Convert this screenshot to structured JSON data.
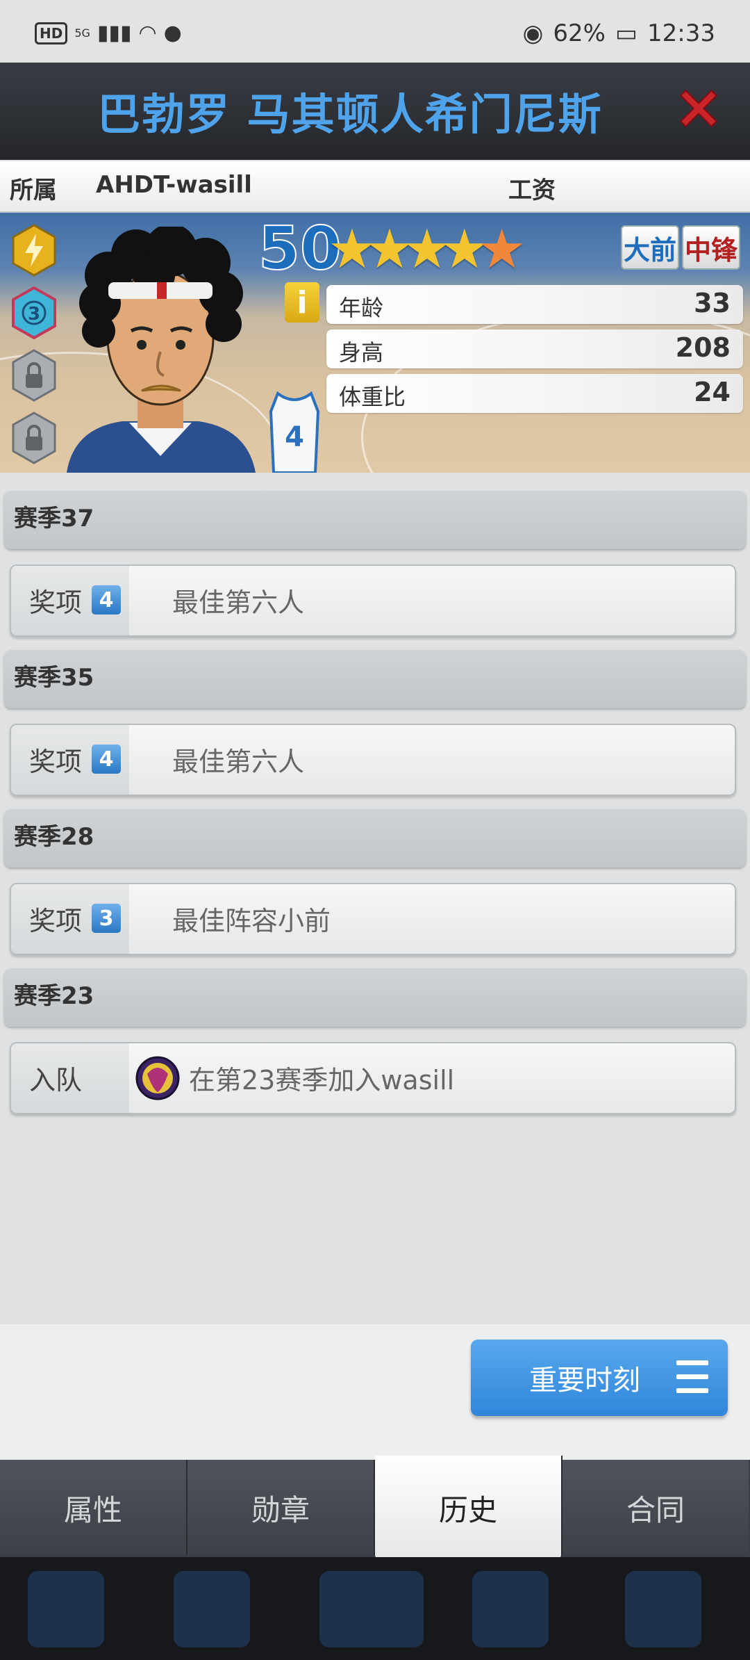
{
  "status_bar": {
    "hd": "HD",
    "network": "5G",
    "battery_pct": "62%",
    "time": "12:33"
  },
  "header": {
    "title": "巴勃罗 马其顿人希门尼斯"
  },
  "team_row": {
    "team_label": "所属",
    "team_value": "AHDT-wasill",
    "salary_label": "工资"
  },
  "player": {
    "rating": "50",
    "stars": 5,
    "position_1": "大前",
    "position_2": "中锋",
    "jersey_number": "4",
    "info_icon": "i",
    "stats": [
      {
        "label": "年龄",
        "value": "33"
      },
      {
        "label": "身高",
        "value": "208"
      },
      {
        "label": "体重比",
        "value": "24"
      }
    ],
    "badges": [
      "lightning-badge",
      "level-3-badge",
      "lock-icon",
      "lock-icon"
    ],
    "badge_level": "3"
  },
  "history": [
    {
      "season": "赛季37",
      "label": "奖项",
      "count": "4",
      "text": "最佳第六人"
    },
    {
      "season": "赛季35",
      "label": "奖项",
      "count": "4",
      "text": "最佳第六人"
    },
    {
      "season": "赛季28",
      "label": "奖项",
      "count": "3",
      "text": "最佳阵容小前"
    },
    {
      "season": "赛季23",
      "label": "入队",
      "text": "在第23赛季加入wasill"
    }
  ],
  "moments_button": {
    "label": "重要时刻"
  },
  "tabs": [
    "属性",
    "勋章",
    "历史",
    "合同"
  ],
  "active_tab": "历史",
  "colors": {
    "title_blue": "#4fa3ea",
    "close_red": "#c8242a",
    "button_blue": "#3a8fde",
    "position_blue": "#1d6dbd",
    "position_red": "#b32020"
  }
}
